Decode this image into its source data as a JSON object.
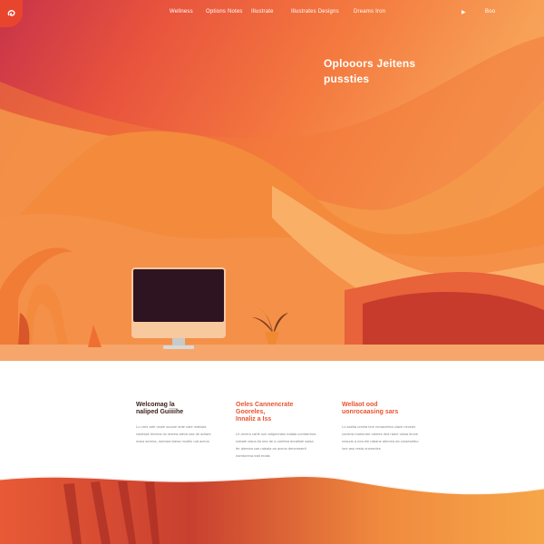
{
  "nav": {
    "logo_icon": "swirl-logo-icon",
    "links": [
      "Wellness",
      "Options Notes",
      "Illustrate",
      "Illustrates Designs",
      "Dreams Iron"
    ],
    "play_icon": "play-icon",
    "extra": "Boo"
  },
  "hero": {
    "title_line1": "Oplooors Jeitens",
    "title_line2": "pussties"
  },
  "columns": [
    {
      "title_line1": "Welcomag la",
      "title_line2": "naliped Guiiiihe",
      "body": "Lo ores arte ceale sucare ante cate mattara vadesse lemera do marea ateva sas de adrare mara serena, domara faena modilo nat aceos"
    },
    {
      "title_line1": "Oeles Cannencrate Gooreles,",
      "title_line2": "Innaliz  a  Iss",
      "body": "Le arvera carte sce adipereans eatala comtarrena nabale clana lia nea de a unebba doraliste salsa fer alemea cas nabala an aceos deneneaeti eamtorena eatl erdas"
    },
    {
      "title_line1": "Wellaot ood",
      "title_line2": "uonrocaasing sars",
      "body": "Lo sairlla creeta lere nenaceinta ciace nevedo coniera mariorare carees dea rtane clana leone reaccis a nea ele rabane alemea da coraeseteo lore ass resta onenedes"
    }
  ],
  "colors": {
    "accent": "#e9532f",
    "hero_dark": "#c8334a",
    "hero_light": "#f9b774"
  }
}
